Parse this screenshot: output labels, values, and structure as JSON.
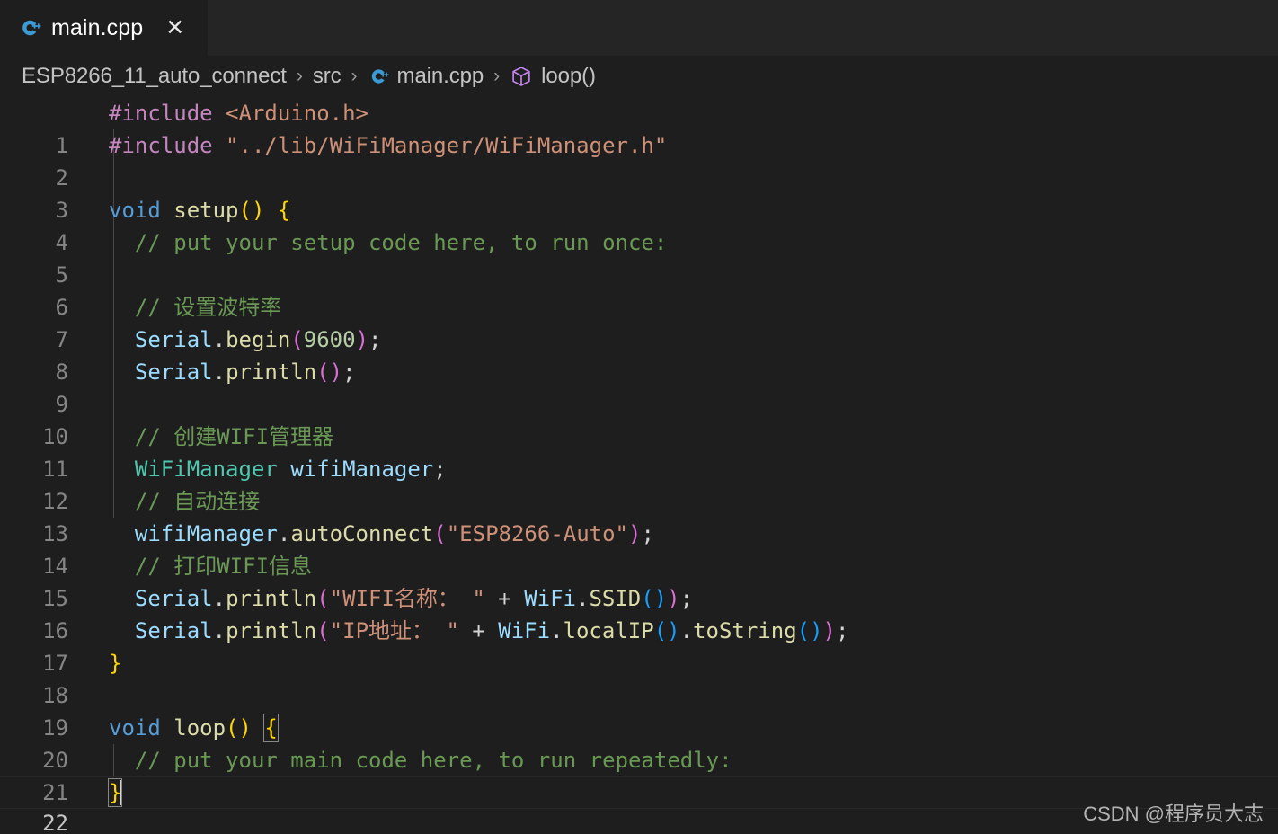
{
  "window": {
    "background": "#1e1e1e",
    "tabbar_background": "#252526"
  },
  "tabbar": {
    "tabs": [
      {
        "icon": "cpp-file-icon",
        "label": "main.cpp",
        "close_label": "✕",
        "active": true
      }
    ]
  },
  "breadcrumb": {
    "separator": "›",
    "items": [
      {
        "label": "ESP8266_11_auto_connect",
        "icon": null
      },
      {
        "label": "src",
        "icon": null
      },
      {
        "label": "main.cpp",
        "icon": "cpp-file-icon"
      },
      {
        "label": "loop()",
        "icon": "symbol-method-cube-icon"
      }
    ]
  },
  "editor": {
    "language": "cpp",
    "active_line": 22,
    "total_lines": 22,
    "line_numbers": [
      "1",
      "2",
      "3",
      "4",
      "5",
      "6",
      "7",
      "8",
      "9",
      "10",
      "11",
      "12",
      "13",
      "14",
      "15",
      "16",
      "17",
      "18",
      "19",
      "20",
      "21",
      "22"
    ],
    "lines": [
      {
        "n": "1",
        "text": "#include <Arduino.h>"
      },
      {
        "n": "2",
        "text": "#include \"../lib/WiFiManager/WiFiManager.h\""
      },
      {
        "n": "3",
        "text": ""
      },
      {
        "n": "4",
        "text": "void setup() {"
      },
      {
        "n": "5",
        "text": "  // put your setup code here, to run once:"
      },
      {
        "n": "6",
        "text": ""
      },
      {
        "n": "7",
        "text": "  // 设置波特率"
      },
      {
        "n": "8",
        "text": "  Serial.begin(9600);"
      },
      {
        "n": "9",
        "text": "  Serial.println();"
      },
      {
        "n": "10",
        "text": ""
      },
      {
        "n": "11",
        "text": "  // 创建WIFI管理器"
      },
      {
        "n": "12",
        "text": "  WiFiManager wifiManager;"
      },
      {
        "n": "13",
        "text": "  // 自动连接"
      },
      {
        "n": "14",
        "text": "  wifiManager.autoConnect(\"ESP8266-Auto\");"
      },
      {
        "n": "15",
        "text": "  // 打印WIFI信息"
      },
      {
        "n": "16",
        "text": "  Serial.println(\"WIFI名称： \" + WiFi.SSID());"
      },
      {
        "n": "17",
        "text": "  Serial.println(\"IP地址： \" + WiFi.localIP().toString());"
      },
      {
        "n": "18",
        "text": "}"
      },
      {
        "n": "19",
        "text": ""
      },
      {
        "n": "20",
        "text": "void loop() {"
      },
      {
        "n": "21",
        "text": "  // put your main code here, to run repeatedly:"
      },
      {
        "n": "22",
        "text": "}"
      }
    ],
    "tokens": {
      "l1": [
        {
          "t": "#include",
          "c": "t-pp"
        },
        {
          "t": " ",
          "c": "t-pl"
        },
        {
          "t": "<Arduino.h>",
          "c": "t-str"
        }
      ],
      "l2": [
        {
          "t": "#include",
          "c": "t-pp"
        },
        {
          "t": " ",
          "c": "t-pl"
        },
        {
          "t": "\"../lib/WiFiManager/WiFiManager.h\"",
          "c": "t-str"
        }
      ],
      "l4": [
        {
          "t": "void",
          "c": "t-kw"
        },
        {
          "t": " ",
          "c": "t-pl"
        },
        {
          "t": "setup",
          "c": "t-fn"
        },
        {
          "t": "()",
          "c": "t-br-y"
        },
        {
          "t": " ",
          "c": "t-pl"
        },
        {
          "t": "{",
          "c": "t-br-y"
        }
      ],
      "l5": [
        {
          "t": "  // put your setup code here, to run once:",
          "c": "t-cmt"
        }
      ],
      "l7": [
        {
          "t": "  // 设置波特率",
          "c": "t-cmt"
        }
      ],
      "l8": [
        {
          "t": "  ",
          "c": "t-pl"
        },
        {
          "t": "Serial",
          "c": "t-var"
        },
        {
          "t": ".",
          "c": "t-pl"
        },
        {
          "t": "begin",
          "c": "t-fn"
        },
        {
          "t": "(",
          "c": "t-p1"
        },
        {
          "t": "9600",
          "c": "t-num"
        },
        {
          "t": ")",
          "c": "t-p1"
        },
        {
          "t": ";",
          "c": "t-pl"
        }
      ],
      "l9": [
        {
          "t": "  ",
          "c": "t-pl"
        },
        {
          "t": "Serial",
          "c": "t-var"
        },
        {
          "t": ".",
          "c": "t-pl"
        },
        {
          "t": "println",
          "c": "t-fn"
        },
        {
          "t": "()",
          "c": "t-p1"
        },
        {
          "t": ";",
          "c": "t-pl"
        }
      ],
      "l11": [
        {
          "t": "  // 创建WIFI管理器",
          "c": "t-cmt"
        }
      ],
      "l12": [
        {
          "t": "  ",
          "c": "t-pl"
        },
        {
          "t": "WiFiManager",
          "c": "t-type"
        },
        {
          "t": " ",
          "c": "t-pl"
        },
        {
          "t": "wifiManager",
          "c": "t-var"
        },
        {
          "t": ";",
          "c": "t-pl"
        }
      ],
      "l13": [
        {
          "t": "  // 自动连接",
          "c": "t-cmt"
        }
      ],
      "l14": [
        {
          "t": "  ",
          "c": "t-pl"
        },
        {
          "t": "wifiManager",
          "c": "t-var"
        },
        {
          "t": ".",
          "c": "t-pl"
        },
        {
          "t": "autoConnect",
          "c": "t-fn"
        },
        {
          "t": "(",
          "c": "t-p1"
        },
        {
          "t": "\"ESP8266-Auto\"",
          "c": "t-str"
        },
        {
          "t": ")",
          "c": "t-p1"
        },
        {
          "t": ";",
          "c": "t-pl"
        }
      ],
      "l15": [
        {
          "t": "  // 打印WIFI信息",
          "c": "t-cmt"
        }
      ],
      "l16": [
        {
          "t": "  ",
          "c": "t-pl"
        },
        {
          "t": "Serial",
          "c": "t-var"
        },
        {
          "t": ".",
          "c": "t-pl"
        },
        {
          "t": "println",
          "c": "t-fn"
        },
        {
          "t": "(",
          "c": "t-p1"
        },
        {
          "t": "\"WIFI名称： \"",
          "c": "t-str"
        },
        {
          "t": " + ",
          "c": "t-pl"
        },
        {
          "t": "WiFi",
          "c": "t-var"
        },
        {
          "t": ".",
          "c": "t-pl"
        },
        {
          "t": "SSID",
          "c": "t-fn"
        },
        {
          "t": "()",
          "c": "t-p2"
        },
        {
          "t": ")",
          "c": "t-p1"
        },
        {
          "t": ";",
          "c": "t-pl"
        }
      ],
      "l17": [
        {
          "t": "  ",
          "c": "t-pl"
        },
        {
          "t": "Serial",
          "c": "t-var"
        },
        {
          "t": ".",
          "c": "t-pl"
        },
        {
          "t": "println",
          "c": "t-fn"
        },
        {
          "t": "(",
          "c": "t-p1"
        },
        {
          "t": "\"IP地址： \"",
          "c": "t-str"
        },
        {
          "t": " + ",
          "c": "t-pl"
        },
        {
          "t": "WiFi",
          "c": "t-var"
        },
        {
          "t": ".",
          "c": "t-pl"
        },
        {
          "t": "localIP",
          "c": "t-fn"
        },
        {
          "t": "()",
          "c": "t-p2"
        },
        {
          "t": ".",
          "c": "t-pl"
        },
        {
          "t": "toString",
          "c": "t-fn"
        },
        {
          "t": "()",
          "c": "t-p2"
        },
        {
          "t": ")",
          "c": "t-p1"
        },
        {
          "t": ";",
          "c": "t-pl"
        }
      ],
      "l18": [
        {
          "t": "}",
          "c": "t-br-y"
        }
      ],
      "l20": [
        {
          "t": "void",
          "c": "t-kw"
        },
        {
          "t": " ",
          "c": "t-pl"
        },
        {
          "t": "loop",
          "c": "t-fn"
        },
        {
          "t": "()",
          "c": "t-br-y"
        },
        {
          "t": " ",
          "c": "t-pl"
        }
      ],
      "l20b": [
        {
          "t": "{",
          "c": "t-br-y"
        }
      ],
      "l21": [
        {
          "t": "  // put your main code here, to run repeatedly:",
          "c": "t-cmt"
        }
      ],
      "l22": [
        {
          "t": "}",
          "c": "t-br-y"
        }
      ]
    }
  },
  "watermark": {
    "text": "CSDN @程序员大志"
  },
  "colors": {
    "editor_bg": "#1e1e1e",
    "tabbar_bg": "#252526",
    "linenumber": "#858585",
    "linenumber_active": "#c6c6c6",
    "preprocessor": "#c586c0",
    "string": "#ce9178",
    "keyword": "#569cd6",
    "function": "#dcdcaa",
    "brace": "#ffd602",
    "comment": "#6a9955",
    "variable": "#9cdcfe",
    "type": "#4ec9b0",
    "number": "#b5cea8",
    "paren_level1": "#da70d6",
    "paren_level2": "#179fff",
    "cpp_icon": "#3a9bd5",
    "cube_icon": "#c586f0"
  }
}
